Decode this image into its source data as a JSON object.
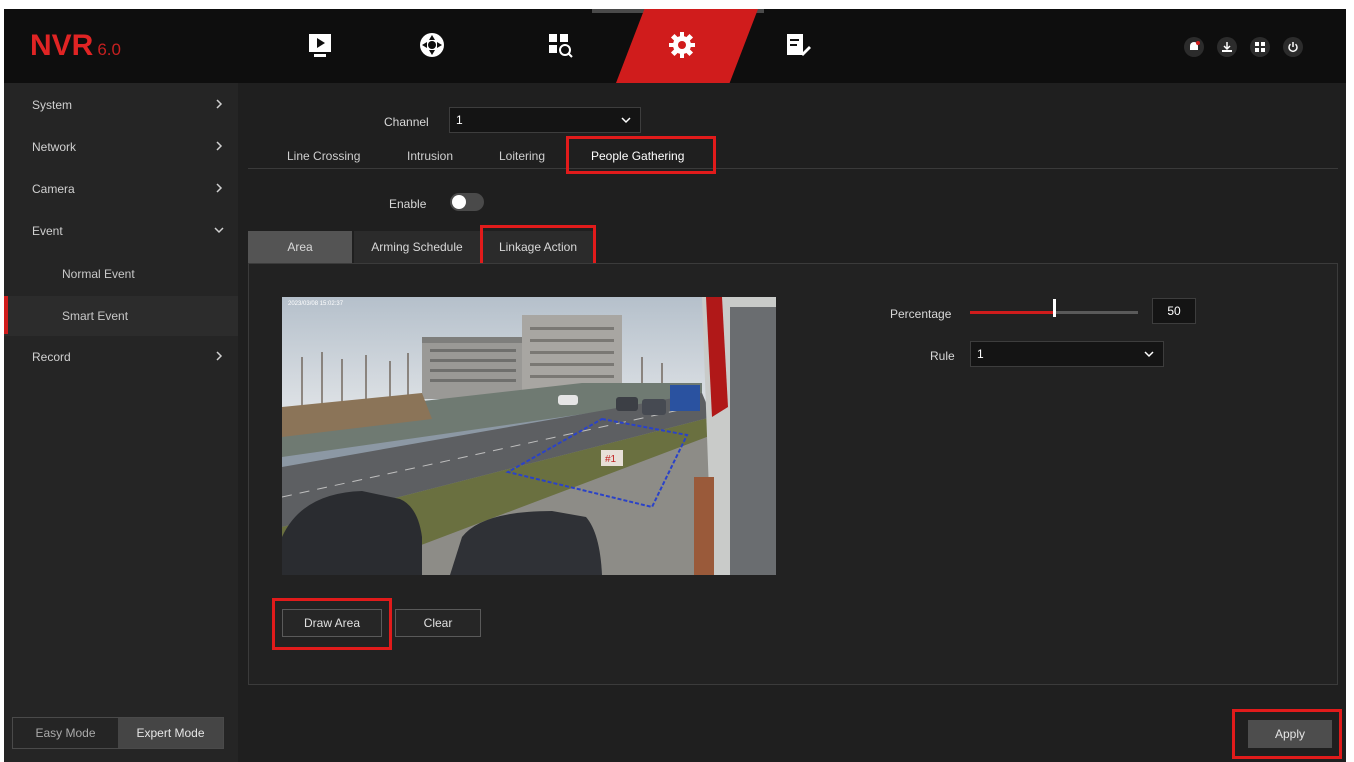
{
  "app": {
    "logo_text": "NVR",
    "logo_version": "6.0",
    "accent_color": "#d01c1c",
    "highlight_color": "#e11b1b"
  },
  "top_nav": {
    "icons": [
      "playback-icon",
      "camera-control-icon",
      "search-icon",
      "settings-icon",
      "maintenance-icon"
    ],
    "active": "settings-icon"
  },
  "top_right": {
    "icons": [
      "alarm-icon",
      "download-icon",
      "layout-icon",
      "power-icon"
    ]
  },
  "sidebar": {
    "items": [
      {
        "label": "System"
      },
      {
        "label": "Network"
      },
      {
        "label": "Camera"
      },
      {
        "label": "Event"
      },
      {
        "label": "Normal Event"
      },
      {
        "label": "Smart Event"
      },
      {
        "label": "Record"
      }
    ],
    "active": "Smart Event",
    "mode_easy": "Easy Mode",
    "mode_expert": "Expert Mode",
    "selected_mode": "Expert Mode"
  },
  "main": {
    "channel_label": "Channel",
    "channel_value": "1",
    "tabs": [
      {
        "label": "Line Crossing"
      },
      {
        "label": "Intrusion"
      },
      {
        "label": "Loitering"
      },
      {
        "label": "People Gathering"
      }
    ],
    "active_tab": "People Gathering",
    "enable_label": "Enable",
    "enable_on": false,
    "subtabs": [
      {
        "label": "Area"
      },
      {
        "label": "Arming Schedule"
      },
      {
        "label": "Linkage Action"
      }
    ],
    "active_subtab": "Area",
    "video": {
      "timestamp": "2023/03/08 15:02:37",
      "area_label": "#1"
    },
    "buttons": {
      "draw_area": "Draw Area",
      "clear": "Clear"
    },
    "percentage_label": "Percentage",
    "percentage_value": "50",
    "percentage_fraction": 0.5,
    "rule_label": "Rule",
    "rule_value": "1",
    "apply": "Apply"
  }
}
